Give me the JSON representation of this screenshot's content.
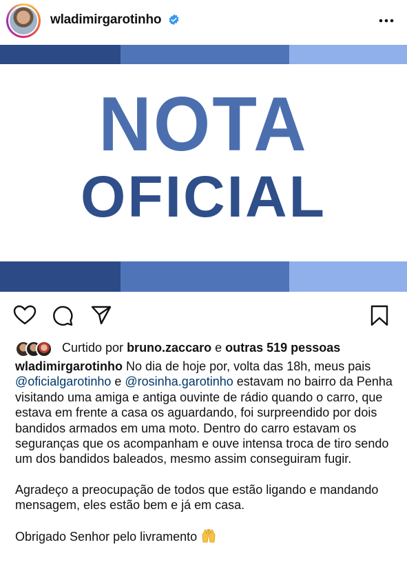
{
  "header": {
    "username": "wladimirgarotinho",
    "verified_icon": "verified-badge-icon",
    "more_icon": "more-options-icon"
  },
  "post_image": {
    "headline_line1": "NOTA",
    "headline_line2": "OFICIAL",
    "colors": {
      "dark_blue": "#2c4b86",
      "mid_blue": "#4f74b8",
      "light_blue": "#8fb0ea"
    }
  },
  "actions": {
    "like_icon": "heart-icon",
    "comment_icon": "comment-icon",
    "share_icon": "share-icon",
    "save_icon": "bookmark-icon"
  },
  "likes": {
    "prefix": "Curtido por",
    "liker": "bruno.zaccaro",
    "connector": "e",
    "others": "outras 519 pessoas"
  },
  "caption": {
    "username": "wladimirgarotinho",
    "text_1": "No dia de hoje por, volta das 18h, meus pais",
    "mention_1": "@oficialgarotinho",
    "connector": "e",
    "mention_2": "@rosinha.garotinho",
    "text_2": "estavam no bairro da Penha visitando uma amiga e antiga ouvinte de rádio quando o carro, que estava em frente a casa os aguardando, foi surpreendido por dois bandidos armados em uma moto. Dentro do carro estavam os seguranças que os acompanham e ouve intensa troca de tiro sendo um dos bandidos baleados, mesmo assim conseguiram fugir.",
    "paragraph_2": "Agradeço a preocupação de todos que estão ligando e mandando mensagem, eles estão bem e já em casa.",
    "paragraph_3": "Obrigado Senhor pelo livramento",
    "emoji_icon": "raising-hands-icon"
  }
}
